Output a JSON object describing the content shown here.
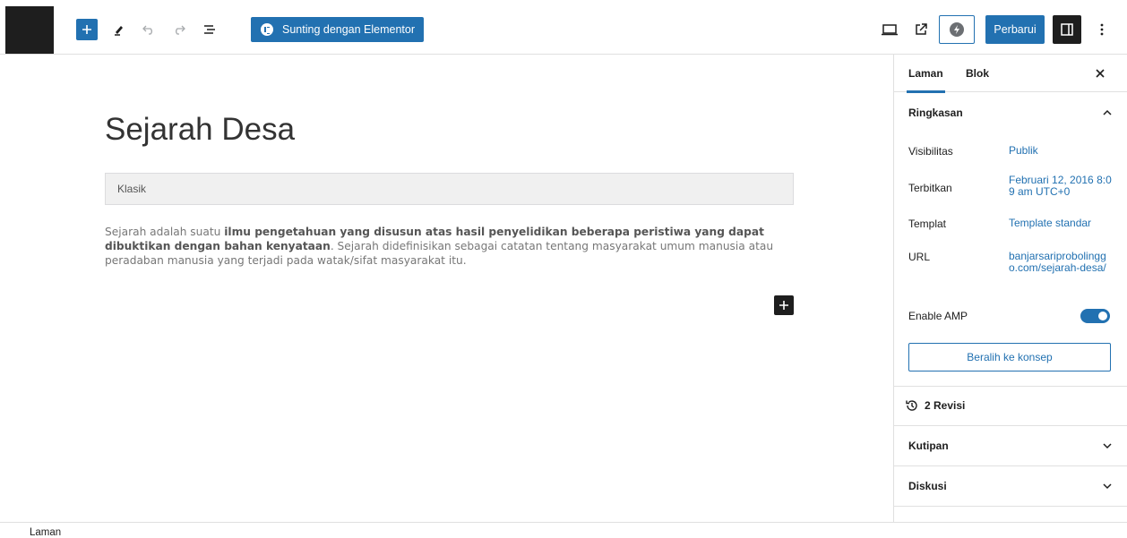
{
  "toolbar": {
    "elementor_label": "Sunting dengan Elementor",
    "update_label": "Perbarui"
  },
  "editor": {
    "title": "Sejarah Desa",
    "classic_block_label": "Klasik",
    "paragraph": {
      "part1": "Sejarah adalah suatu ",
      "bold1": "ilmu pengetahuan yang disusun atas hasil penyelidikan beberapa peristiwa yang dapat dibuktikan dengan bahan kenyataan",
      "part2": ". Sejarah didefinisikan sebagai catatan tentang masyarakat umum manusia atau peradaban manusia yang terjadi pada watak/sifat masyarakat itu."
    }
  },
  "sidebar": {
    "tabs": [
      {
        "label": "Laman",
        "active": true
      },
      {
        "label": "Blok",
        "active": false
      }
    ],
    "summary": {
      "title": "Ringkasan",
      "rows": [
        {
          "label": "Visibilitas",
          "value": "Publik"
        },
        {
          "label": "Terbitkan",
          "value": "Februari 12, 2016 8:09 am UTC+0"
        },
        {
          "label": "Templat",
          "value": "Template standar"
        },
        {
          "label": "URL",
          "value": "banjarsariprobolinggo.com/sejarah-desa/"
        }
      ],
      "amp_label": "Enable AMP",
      "amp_enabled": true,
      "draft_button": "Beralih ke konsep"
    },
    "revisions": "2 Revisi",
    "sections": [
      {
        "label": "Kutipan"
      },
      {
        "label": "Diskusi"
      }
    ]
  },
  "footer": {
    "breadcrumb": "Laman"
  },
  "colors": {
    "accent": "#2271b1",
    "dark": "#1e1e1e"
  }
}
